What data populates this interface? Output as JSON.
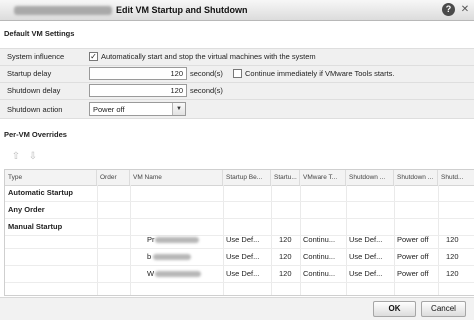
{
  "window": {
    "title": "Edit VM Startup and Shutdown",
    "help_glyph": "?",
    "close_glyph": "✕"
  },
  "default_settings": {
    "heading": "Default VM Settings",
    "system_influence": {
      "label": "System influence",
      "checked": true,
      "check_glyph": "✓",
      "text": "Automatically start and stop the virtual machines with the system"
    },
    "startup_delay": {
      "label": "Startup delay",
      "value": "120",
      "unit": "second(s)",
      "continue_checked": false,
      "continue_text": "Continue immediately if VMware Tools starts."
    },
    "shutdown_delay": {
      "label": "Shutdown delay",
      "value": "120",
      "unit": "second(s)"
    },
    "shutdown_action": {
      "label": "Shutdown action",
      "value": "Power off",
      "arrow_glyph": "▼"
    }
  },
  "overrides": {
    "heading": "Per-VM Overrides",
    "move_up_glyph": "⇧",
    "move_down_glyph": "⇩",
    "columns": [
      "Type",
      "Order",
      "VM Name",
      "Startup Be...",
      "Startu...",
      "VMware T...",
      "Shutdown ...",
      "Shutdown ...",
      "Shutd..."
    ],
    "groups": [
      "Automatic Startup",
      "Any Order",
      "Manual Startup"
    ],
    "rows": [
      {
        "name": "Pr",
        "startup_behavior": "Use Def...",
        "startup_delay": "120",
        "vmware_tools": "Continu...",
        "shutdown_behavior": "Use Def...",
        "shutdown_action": "Power off",
        "shutdown_delay": "120"
      },
      {
        "name": "b",
        "startup_behavior": "Use Def...",
        "startup_delay": "120",
        "vmware_tools": "Continu...",
        "shutdown_behavior": "Use Def...",
        "shutdown_action": "Power off",
        "shutdown_delay": "120"
      },
      {
        "name": "W",
        "startup_behavior": "Use Def...",
        "startup_delay": "120",
        "vmware_tools": "Continu...",
        "shutdown_behavior": "Use Def...",
        "shutdown_action": "Power off",
        "shutdown_delay": "120"
      }
    ]
  },
  "footer": {
    "ok_label": "OK",
    "cancel_label": "Cancel"
  }
}
